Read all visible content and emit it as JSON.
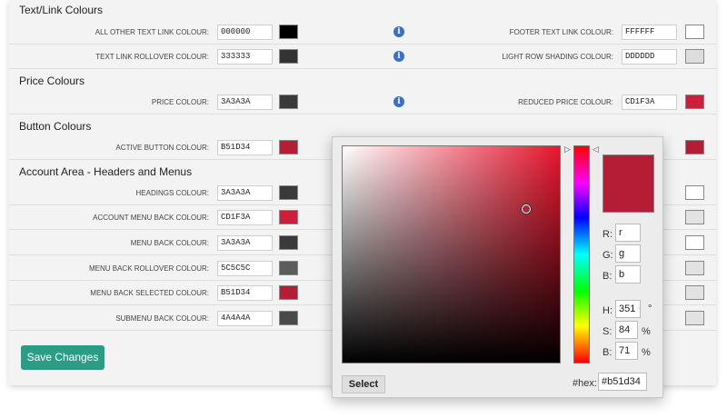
{
  "sections": {
    "text_link": "Text/Link Colours",
    "price": "Price Colours",
    "button": "Button Colours",
    "account": "Account Area - Headers and Menus"
  },
  "text_rows": [
    {
      "left_label": "ALL OTHER TEXT LINK COLOUR:",
      "left_hex": "000000",
      "left_color": "#000000",
      "right_label": "FOOTER TEXT LINK COLOUR:",
      "right_hex": "FFFFFF",
      "right_color": "#ffffff"
    },
    {
      "left_label": "TEXT LINK ROLLOVER COLOUR:",
      "left_hex": "333333",
      "left_color": "#333333",
      "right_label": "LIGHT ROW SHADING COLOUR:",
      "right_hex": "DDDDDD",
      "right_color": "#dddddd"
    }
  ],
  "price_row": {
    "left_label": "PRICE COLOUR:",
    "left_hex": "3A3A3A",
    "left_color": "#3a3a3a",
    "right_label": "REDUCED PRICE COLOUR:",
    "right_hex": "CD1F3A",
    "right_color": "#cd1f3a"
  },
  "button_row": {
    "left_label": "ACTIVE BUTTON COLOUR:",
    "left_hex": "B51D34",
    "left_color": "#b51d34",
    "right_color": "#b51d34"
  },
  "account_rows": [
    {
      "label": "HEADINGS COLOUR:",
      "hex": "3A3A3A",
      "color": "#3a3a3a",
      "right_color": "#ffffff"
    },
    {
      "label": "ACCOUNT MENU BACK COLOUR:",
      "hex": "CD1F3A",
      "color": "#cd1f3a",
      "right_color": "#e2e2e2"
    },
    {
      "label": "MENU BACK COLOUR:",
      "hex": "3A3A3A",
      "color": "#3a3a3a",
      "right_color": "#ffffff"
    },
    {
      "label": "MENU BACK ROLLOVER COLOUR:",
      "hex": "5C5C5C",
      "color": "#5c5c5c",
      "right_color": "#e2e2e2"
    },
    {
      "label": "MENU BACK SELECTED COLOUR:",
      "hex": "B51D34",
      "color": "#b51d34",
      "right_color": "#e2e2e2"
    },
    {
      "label": "SUBMENU BACK COLOUR:",
      "hex": "4A4A4A",
      "color": "#4a4a4a",
      "right_color": "#e2e2e2"
    }
  ],
  "info_icon": "i",
  "save_label": "Save Changes",
  "picker": {
    "hue_color": "#e8162e",
    "selected_color": "#b51d34",
    "r_label": "R:",
    "r_value": "r",
    "g_label": "G:",
    "g_value": "g",
    "b_label": "B:",
    "b_value": "b",
    "h_label": "H:",
    "h_value": "351",
    "h_unit": "°",
    "s_label": "S:",
    "s_value": "84",
    "s_unit": "%",
    "bri_label": "B:",
    "bri_value": "71",
    "bri_unit": "%",
    "hex_label": "#hex:",
    "hex_value": "#b51d34",
    "select_label": "Select",
    "arrow_right": "▷",
    "arrow_left": "◁"
  }
}
